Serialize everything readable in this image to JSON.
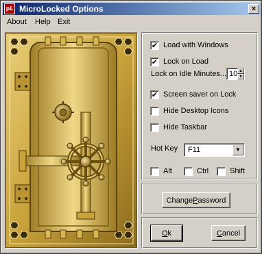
{
  "window": {
    "title": "MicroLocked Options",
    "icon_text": "pL",
    "close_glyph": "×"
  },
  "menu": {
    "items": [
      "About",
      "Help",
      "Exit"
    ]
  },
  "options": {
    "load_with_windows": {
      "label": "Load with Windows",
      "checked": true
    },
    "lock_on_load": {
      "label": "Lock on Load",
      "checked": true
    },
    "lock_idle_label": "Lock on Idle Minutes...",
    "idle_minutes": "10",
    "screen_saver_on_lock": {
      "label": "Screen saver on Lock",
      "checked": true
    },
    "hide_desktop_icons": {
      "label": "Hide Desktop Icons",
      "checked": false
    },
    "hide_taskbar": {
      "label": "Hide Taskbar",
      "checked": false
    },
    "hotkey_label": "Hot Key",
    "hotkey_value": "F11",
    "alt": {
      "label": "Alt",
      "checked": false
    },
    "ctrl": {
      "label": "Ctrl",
      "checked": false
    },
    "shift": {
      "label": "Shift",
      "checked": false
    }
  },
  "buttons": {
    "change_password_pre": "Change ",
    "change_password_u": "P",
    "change_password_post": "assword",
    "ok_u": "O",
    "ok_post": "k",
    "cancel_pre": "",
    "cancel_u": "C",
    "cancel_post": "ancel"
  },
  "colors": {
    "titlebar_start": "#0a246a",
    "titlebar_end": "#a6caf0",
    "vault_gold": "#c9a23a"
  }
}
